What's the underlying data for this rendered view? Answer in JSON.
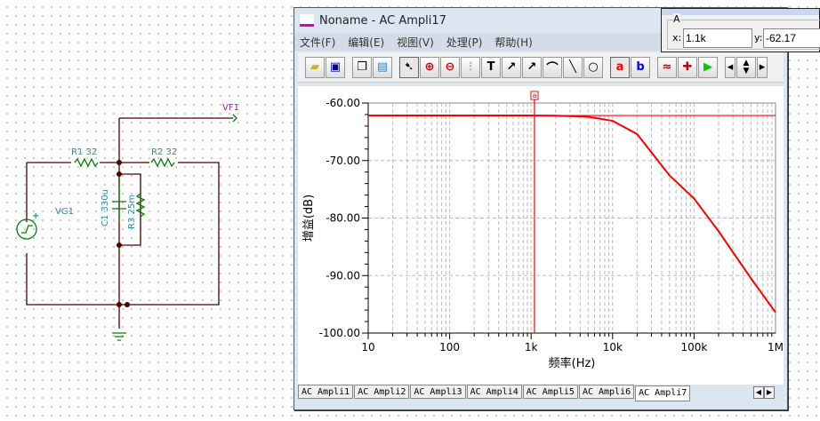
{
  "schematic": {
    "labels": {
      "vf1": "VF1",
      "r1": "R1 32",
      "r2": "R2 32",
      "vg1": "VG1",
      "c1": "C1 330u",
      "r3": "R3 25m"
    }
  },
  "window": {
    "title": "Noname - AC Ampli17",
    "menu": [
      "文件(F)",
      "编辑(E)",
      "视图(V)",
      "处理(P)",
      "帮助(H)"
    ],
    "toolbar": {
      "icons": [
        "open-folder",
        "save",
        "copy",
        "paste",
        "pointer",
        "zoom-in",
        "zoom-100",
        "grid",
        "text",
        "annotate-1",
        "annotate-2",
        "annotate-3",
        "line",
        "circle",
        "cursor-a",
        "cursor-b",
        "add-trace",
        "probe",
        "run",
        "arrow-left",
        "arrow-up-down",
        "arrow-right"
      ],
      "text_glyph": "T",
      "cursor_a": "a",
      "cursor_b": "b"
    },
    "tabs": [
      "AC Ampli1",
      "AC Ampli2",
      "AC Ampli3",
      "AC Ampli4",
      "AC Ampli5",
      "AC Ampli6",
      "AC Ampli7"
    ],
    "active_tab": 6
  },
  "cursor_panel": {
    "group": "A",
    "x_label": "x:",
    "x_value": "1.1k",
    "y_label": "y:",
    "y_value": "-62.17"
  },
  "chart_data": {
    "type": "line",
    "xlabel": "频率(Hz)",
    "ylabel": "增益(dB)",
    "xscale": "log",
    "xlim": [
      10,
      1000000
    ],
    "ylim": [
      -100,
      -60
    ],
    "xticks": [
      "10",
      "100",
      "1k",
      "10k",
      "100k",
      "1M"
    ],
    "xtick_values": [
      10,
      100,
      1000,
      10000,
      100000,
      1000000
    ],
    "yticks": [
      "-60.00",
      "-70.00",
      "-80.00",
      "-90.00",
      "-100.00"
    ],
    "ytick_values": [
      -60,
      -70,
      -80,
      -90,
      -100
    ],
    "grid": true,
    "series": [
      {
        "color": "#ff0000",
        "x": [
          10,
          100,
          1000,
          2000,
          5000,
          10000,
          20000,
          50000,
          100000,
          200000,
          500000,
          1000000
        ],
        "y": [
          -62.17,
          -62.17,
          -62.17,
          -62.2,
          -62.4,
          -63.1,
          -65.4,
          -72.6,
          -76.6,
          -82.3,
          -90.5,
          -96.4
        ]
      }
    ],
    "cursor": {
      "label": "a",
      "x": 1100,
      "y": -62.17
    }
  }
}
